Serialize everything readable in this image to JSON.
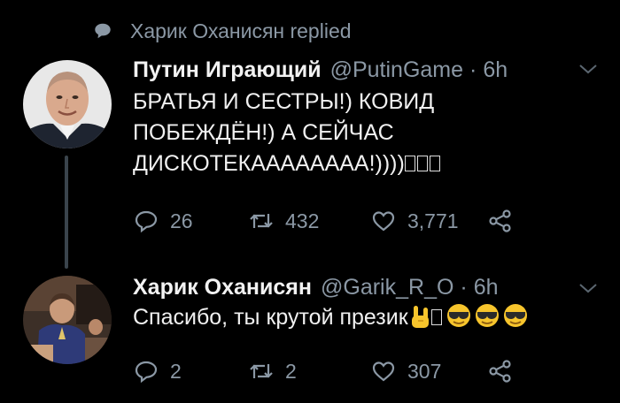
{
  "context": {
    "icon": "speech-bubble-icon",
    "text": "Харик Оханисян replied"
  },
  "tweets": [
    {
      "name": "Путин Играющий",
      "handle": "@PutinGame",
      "dot": "·",
      "time": "6h",
      "text": "БРАТЬЯ И СЕСТРЫ!) КОВИД ПОБЕЖДЁН!) А СЕЙЧАС ДИСКОТЕКАААААААА!))))",
      "stats": {
        "replies": "26",
        "retweets": "432",
        "likes": "3,771"
      }
    },
    {
      "name": "Харик Оханисян",
      "handle": "@Garik_R_O",
      "dot": "·",
      "time": "6h",
      "text": "Спасибо, ты крутой презик",
      "stats": {
        "replies": "2",
        "retweets": "2",
        "likes": "307"
      }
    }
  ],
  "colors": {
    "background": "#000000",
    "muted": "#8b98a5",
    "text": "#e7e9ea",
    "thread_line": "#3a444c"
  }
}
